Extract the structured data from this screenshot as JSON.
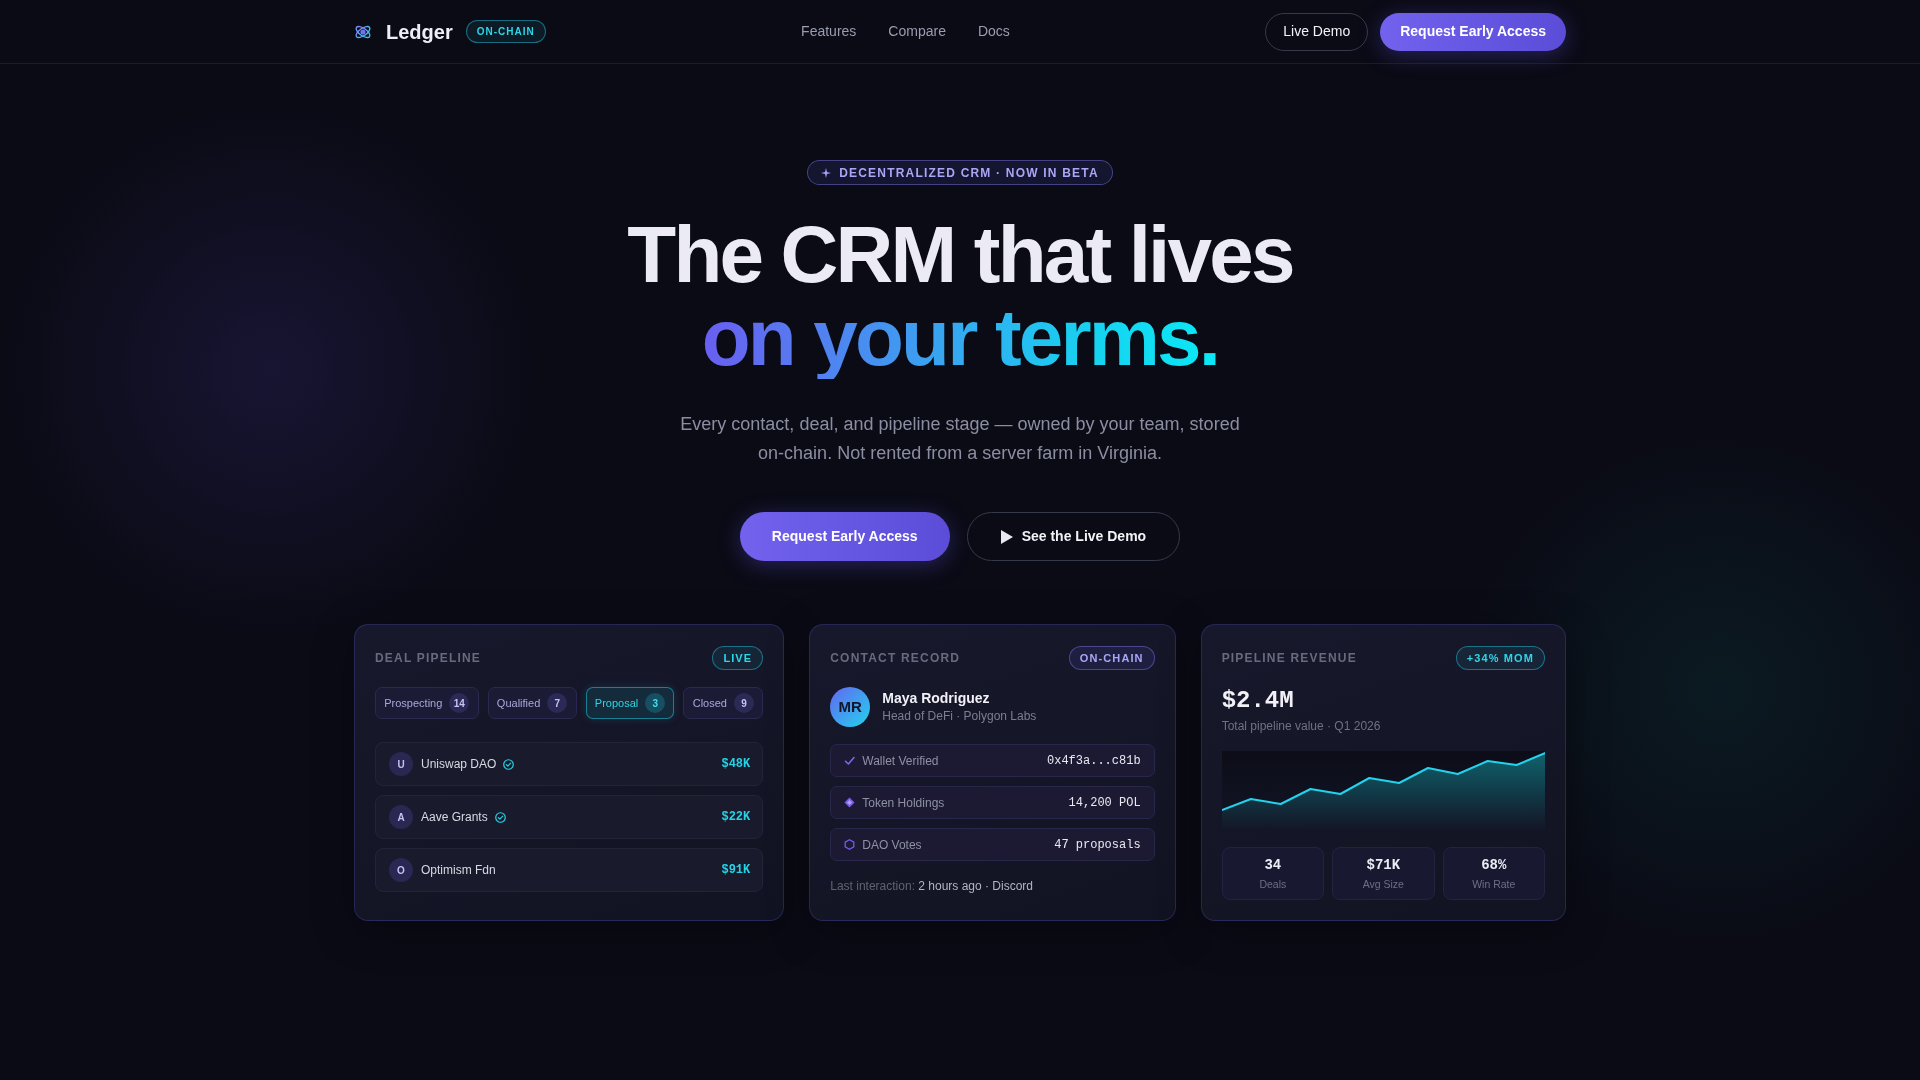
{
  "navbar": {
    "brand": "Ledger",
    "brand_badge": "ON-CHAIN",
    "links": [
      {
        "label": "Features"
      },
      {
        "label": "Compare"
      },
      {
        "label": "Docs"
      }
    ],
    "buttons": [
      {
        "label": "Live Demo",
        "kind": "outline"
      },
      {
        "label": "Request Early Access",
        "kind": "primary"
      }
    ]
  },
  "hero": {
    "badge": "DECENTRALIZED CRM · NOW IN BETA",
    "title_line_1": "The CRM that lives",
    "title_line_2": "on your terms.",
    "subtitle": "Every contact, deal, and pipeline stage — owned by your team, stored on-chain. Not rented from a server farm in Virginia.",
    "buttons": [
      {
        "label": "Request Early Access",
        "kind": "primary"
      },
      {
        "label": "See the Live Demo",
        "kind": "play"
      }
    ]
  },
  "deal_pipeline": {
    "title": "DEAL PIPELINE",
    "badge": "LIVE",
    "stages": [
      {
        "label": "Prospecting",
        "count": "14",
        "selected": false
      },
      {
        "label": "Qualified",
        "count": "7",
        "selected": false
      },
      {
        "label": "Proposal",
        "count": "3",
        "selected": true
      },
      {
        "label": "Closed",
        "count": "9",
        "selected": false
      }
    ],
    "deals": [
      {
        "initial": "U",
        "name": "Uniswap DAO",
        "verified": true,
        "amount": "$48K"
      },
      {
        "initial": "A",
        "name": "Aave Grants",
        "verified": true,
        "amount": "$22K"
      },
      {
        "initial": "O",
        "name": "Optimism Fdn",
        "verified": false,
        "amount": "$91K"
      }
    ]
  },
  "contact_record": {
    "title": "CONTACT RECORD",
    "badge": "ON-CHAIN",
    "initials": "MR",
    "name": "Maya Rodriguez",
    "role": "Head of DeFi · Polygon Labs",
    "fields": [
      {
        "kind": "check",
        "label": "Wallet Verified",
        "value": "0x4f3a...c81b"
      },
      {
        "kind": "diamond",
        "label": "Token Holdings",
        "value": "14,200 POL"
      },
      {
        "kind": "hexagon",
        "label": "DAO Votes",
        "value": "47 proposals"
      }
    ],
    "last_interaction": {
      "label": "Last interaction:",
      "value": "2 hours ago · Discord"
    }
  },
  "pipeline_revenue": {
    "title": "PIPELINE REVENUE",
    "badge": "+34% MOM",
    "total": "$2.4M",
    "caption": "Total pipeline value · Q1 2026",
    "stats": [
      {
        "value": "34",
        "label": "Deals"
      },
      {
        "value": "$71K",
        "label": "Avg Size"
      },
      {
        "value": "68%",
        "label": "Win Rate"
      }
    ]
  }
}
